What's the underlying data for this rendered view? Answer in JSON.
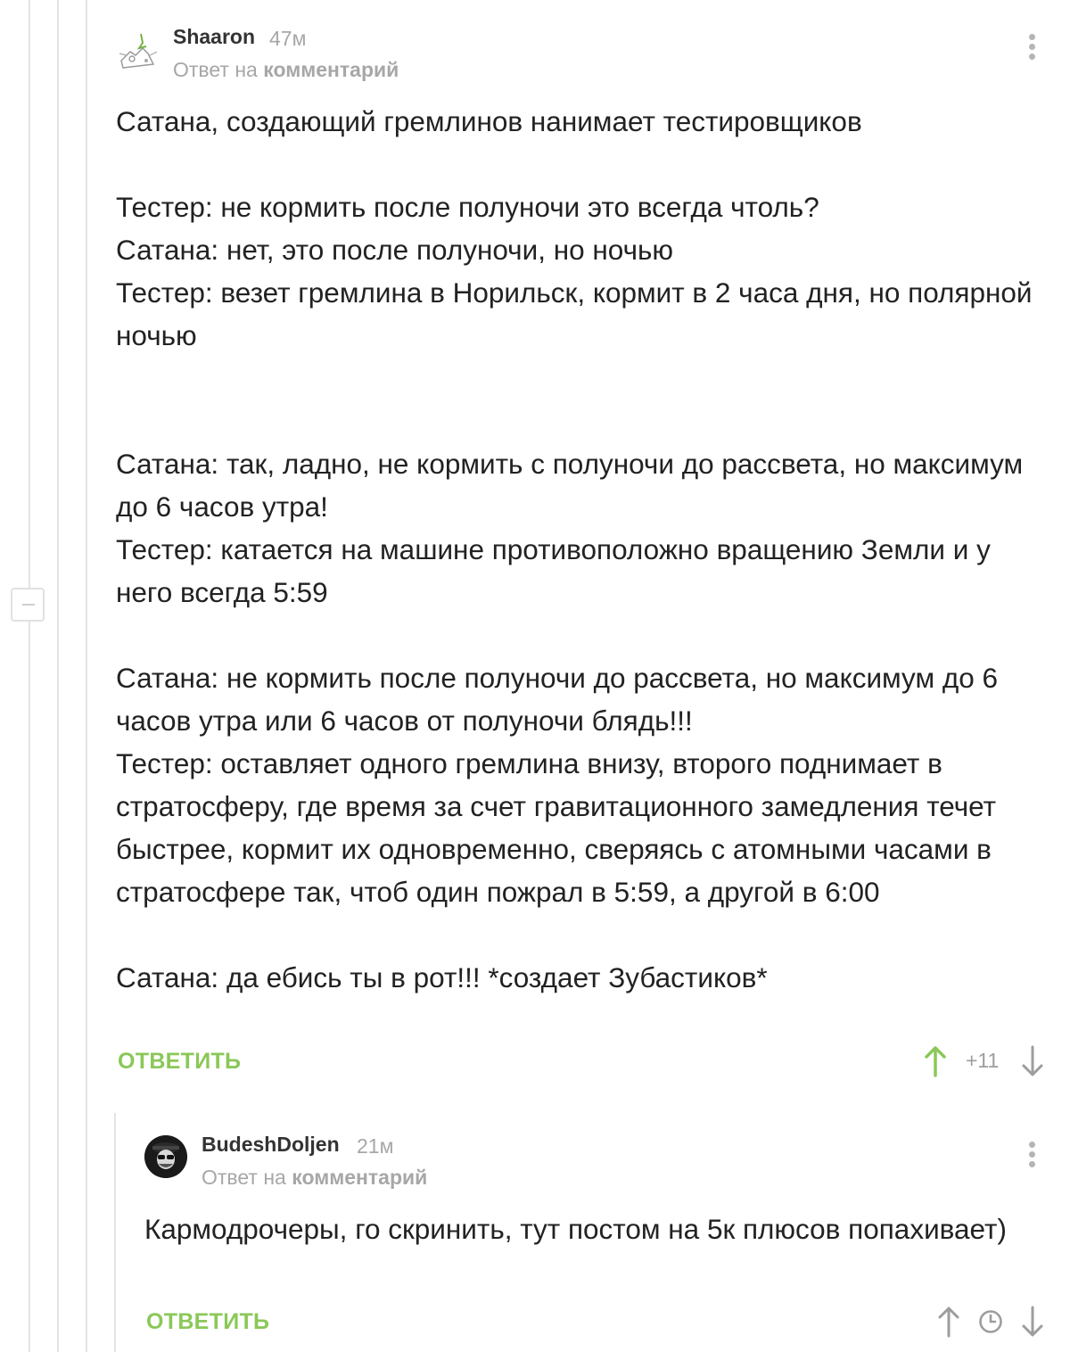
{
  "comments": [
    {
      "author": "Shaaron",
      "time": "47м",
      "reply_prefix": "Ответ на",
      "reply_link": "комментарий",
      "paragraphs": [
        "Сатана, создающий гремлинов нанимает тестировщиков",
        "",
        "Тестер: не кормить после полуночи это всегда чтоль?",
        "Сатана: нет, это после полуночи, но ночью",
        "Тестер: везет гремлина в Норильск, кормит в 2 часа дня, но полярной ночью",
        "",
        "",
        "Сатана: так, ладно, не кормить с полуночи до рассвета, но максимум до 6 часов утра!",
        "Тестер: катается на машине противоположно вращению Земли и у него всегда 5:59",
        "",
        "Сатана: не кормить после полуночи до рассвета, но максимум до 6 часов утра или 6 часов от полуночи блядь!!!",
        "Тестер: оставляет одного гремлина внизу, второго поднимает в стратосферу, где время за счет гравитационного замедления течет быстрее, кормит их одновременно, сверяясь с атомными часами в стратосфере так, чтоб один пожрал в 5:59, а другой в 6:00",
        "",
        "Сатана: да ебись ты в рот!!! *создает Зубастиков*"
      ],
      "reply_label": "ОТВЕТИТЬ",
      "rating": "+11",
      "upvoted": true
    },
    {
      "author": "BudeshDoljen",
      "time": "21м",
      "reply_prefix": "Ответ на",
      "reply_link": "комментарий",
      "paragraphs": [
        "Кармодрочеры, го скринить, тут постом на 5к плюсов попахивает)"
      ],
      "reply_label": "ОТВЕТИТЬ"
    }
  ],
  "colors": {
    "accent_green": "#8ac858",
    "muted": "#a7a7a7",
    "text": "#222222",
    "thread_line": "#e4e4e4"
  },
  "icons": [
    "collapse-icon",
    "menu-dots-icon",
    "arrow-up-icon",
    "arrow-down-icon",
    "clock-icon"
  ]
}
